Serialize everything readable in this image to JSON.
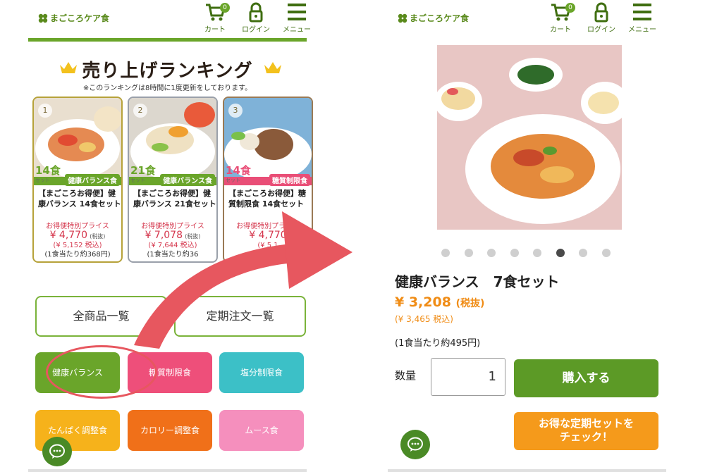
{
  "header": {
    "logo_text": "まごころケア食",
    "cart_label": "カート",
    "cart_count": "0",
    "login_label": "ログイン",
    "menu_label": "メニュー"
  },
  "ranking": {
    "title": "売り上げランキング",
    "note": "※このランキングは8時間に1度更新をしております。",
    "cards": [
      {
        "rank": "1",
        "count": "14食",
        "count_unit": "セット",
        "category": "健康バランス食",
        "name": "【まごころお得便】健康バランス 14食セット",
        "special_label": "お得便特別プライス",
        "price": "¥ 4,770",
        "price_tax_label": "(税抜)",
        "price_incl": "(¥ 5,152 税込)",
        "per_meal": "(1食当たり約368円)"
      },
      {
        "rank": "2",
        "count": "21食",
        "count_unit": "セット",
        "category": "健康バランス食",
        "name": "【まごころお得便】健康バランス 21食セット",
        "special_label": "お得便特別プライス",
        "price": "¥ 7,078",
        "price_tax_label": "(税抜)",
        "price_incl": "(¥ 7,644 税込)",
        "per_meal": "(1食当たり約36"
      },
      {
        "rank": "3",
        "count": "14食",
        "count_unit": "セット",
        "category": "糖質制限食",
        "name": "【まごころお得便】糖質制限食 14食セット",
        "special_label": "お得便特別プライス",
        "price": "¥ 4,770",
        "price_tax_label": "",
        "price_incl": "(¥ 5,1",
        "per_meal": ""
      }
    ]
  },
  "nav": {
    "all_products": "全商品一覧",
    "subscription_list": "定期注文一覧"
  },
  "categories": [
    {
      "label": "健康バランス",
      "color": "#6aa52a"
    },
    {
      "label": "糖質制限食",
      "color": "#ee4f7a"
    },
    {
      "label": "塩分制限食",
      "color": "#3cc0c7"
    },
    {
      "label": "たんぱく調整食",
      "color": "#f6b21b"
    },
    {
      "label": "カロリー調整食",
      "color": "#f07019"
    },
    {
      "label": "ムース食",
      "color": "#f58fbd"
    }
  ],
  "product": {
    "title": "健康バランス　7食セット",
    "price": "¥ 3,208",
    "price_tax_label": "(税抜)",
    "price_incl": "(¥ 3,465 税込)",
    "per_meal": "(1食当たり約495円)",
    "qty_label": "数量",
    "qty_value": "1",
    "buy_label": "購入する",
    "subscription_line1": "お得な定期セットを",
    "subscription_line2": "チェック！",
    "carousel_total": 8,
    "carousel_active_index": 5
  },
  "colors": {
    "brand_green": "#6aa52a",
    "price_red": "#d5374d",
    "price_orange": "#f08c15",
    "arrow": "#e7575f"
  }
}
